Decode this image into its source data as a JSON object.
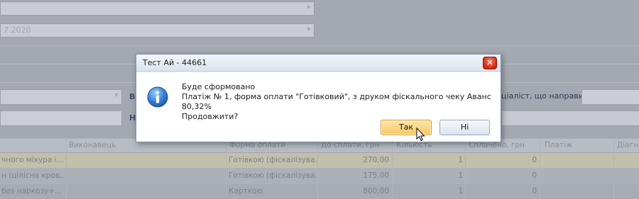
{
  "background": {
    "date_value": "7.2020",
    "label_vy": "Ви",
    "label_na": "На",
    "label_specialist": "ціаліст, що направив",
    "grid": {
      "columns": [
        "Виконавець",
        "Форма оплати",
        "До сплати, грн",
        "Кількість",
        "Сплачено, грн",
        "Платіж",
        "Діагн"
      ],
      "rows": [
        {
          "service": "чного міхура і...",
          "payment_form": "Готівкою (фіскалізува...",
          "amount": "270,00",
          "qty": "1",
          "paid": "0"
        },
        {
          "service": "н (цілісна кров,...",
          "payment_form": "Готівкою (фіскалізува...",
          "amount": "175,00",
          "qty": "1",
          "paid": "0"
        },
        {
          "service": " без наркозу+...",
          "payment_form": "Карткою",
          "amount": "800,00",
          "qty": "1",
          "paid": "0"
        }
      ]
    }
  },
  "dialog": {
    "title": "Тест Ай - 44661",
    "message_line1": "Буде сформовано",
    "message_line2": "Платіж № 1, форма оплати \"Готівковий\", з друком фіскального чеку Аванс 80,32%",
    "message_line3": "Продовжити?",
    "yes_label": "Так",
    "no_label": "Ні",
    "close_glyph": "✕",
    "icon": "info-icon"
  },
  "colors": {
    "accent_yes": "#f7c767",
    "close_red": "#d22a0f",
    "info_blue": "#2f6fc0"
  }
}
